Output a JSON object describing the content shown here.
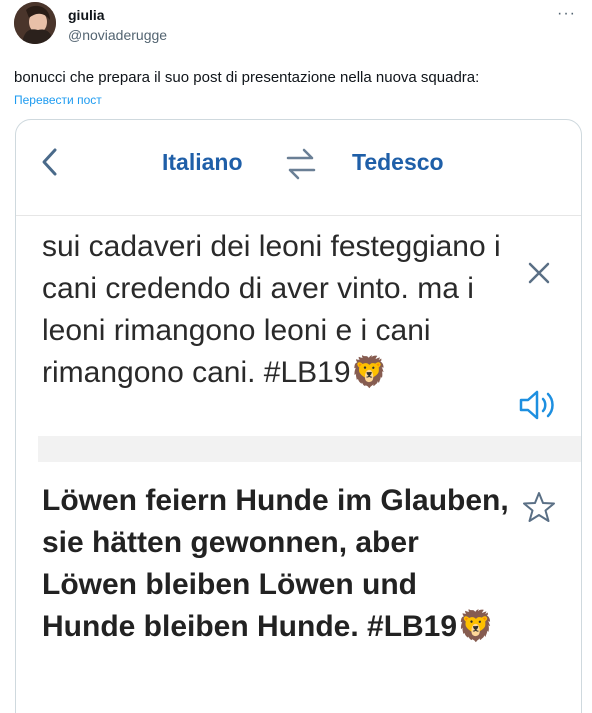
{
  "tweet": {
    "display_name": "giulia",
    "handle": "@noviaderugge",
    "more_icon": "ellipsis-icon",
    "text": "bonucci che prepara il suo post di presentazione nella nuova squadra:",
    "translate_link": "Перевести пост"
  },
  "translator": {
    "back_icon": "chevron-left-icon",
    "source_language": "Italiano",
    "swap_icon": "swap-arrows-icon",
    "target_language": "Tedesco",
    "source_text": "sui cadaveri dei leoni festeggiano i cani credendo di aver vinto. ma i leoni rimangono leoni e i cani rimangono cani. #LB19",
    "source_emoji": "🦁",
    "target_text": "Löwen feiern Hunde im Glauben, sie hätten gewonnen, aber Löwen bleiben Löwen und Hunde bleiben Hunde. #LB19",
    "target_emoji": "🦁",
    "close_icon": "close-icon",
    "speaker_icon": "speaker-icon",
    "star_icon": "star-icon"
  },
  "colors": {
    "link": "#1d9bf0",
    "language": "#1f5fa8",
    "icon": "#4a6a8a"
  }
}
